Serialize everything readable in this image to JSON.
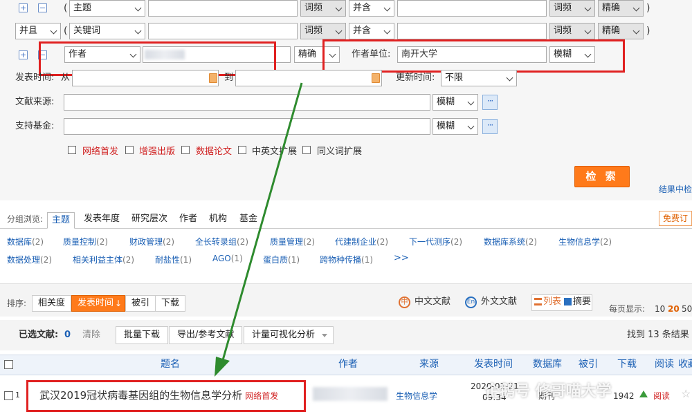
{
  "row1": {
    "field": "主题",
    "freq1": "词频",
    "logic": "并含",
    "freq2": "词频",
    "match": "精确"
  },
  "row2": {
    "op": "并且",
    "field": "关键词",
    "freq1": "词频",
    "logic": "并含",
    "freq2": "词频",
    "match": "精确"
  },
  "row3": {
    "field": "作者",
    "match": "精确",
    "org_label": "作者单位:",
    "org_value": "南开大学",
    "org_match": "模糊"
  },
  "date_row": {
    "label": "发表时间:",
    "from": "从",
    "to": "到",
    "update_label": "更新时间:",
    "update_value": "不限"
  },
  "source_row": {
    "label": "文献来源:",
    "match": "模糊",
    "more": "···"
  },
  "fund_row": {
    "label": "支持基金:",
    "match": "模糊",
    "more": "···"
  },
  "options": [
    {
      "label": "网络首发"
    },
    {
      "label": "增强出版"
    },
    {
      "label": "数据论文"
    },
    {
      "label": "中英文扩展"
    },
    {
      "label": "同义词扩展"
    }
  ],
  "search_button": "检 索",
  "results_link": "结果中检",
  "group": {
    "label": "分组浏览:",
    "tabs": [
      "主题",
      "发表年度",
      "研究层次",
      "作者",
      "机构",
      "基金"
    ],
    "free_sub": "免费订",
    "row1": [
      {
        "name": "数据库",
        "count": "(2)"
      },
      {
        "name": "质量控制",
        "count": "(2)"
      },
      {
        "name": "财政管理",
        "count": "(2)"
      },
      {
        "name": "全长转录组",
        "count": "(2)"
      },
      {
        "name": "质量管理",
        "count": "(2)"
      },
      {
        "name": "代建制企业",
        "count": "(2)"
      },
      {
        "name": "下一代测序",
        "count": "(2)"
      },
      {
        "name": "数据库系统",
        "count": "(2)"
      },
      {
        "name": "生物信息学",
        "count": "(2)"
      }
    ],
    "row2": [
      {
        "name": "数据处理",
        "count": "(2)"
      },
      {
        "name": "相关利益主体",
        "count": "(2)"
      },
      {
        "name": "耐盐性",
        "count": "(1)"
      },
      {
        "name": "AGO",
        "count": "(1)"
      },
      {
        "name": "蛋白质",
        "count": "(1)"
      },
      {
        "name": "跨物种传播",
        "count": "(1)"
      }
    ],
    "more": ">>"
  },
  "sort": {
    "label": "排序:",
    "buttons": [
      "相关度",
      "发表时间",
      "被引",
      "下载"
    ],
    "cn_docs": "中文文献",
    "foreign_docs": "外文文献",
    "list_view": "列表",
    "abstract_view": "摘要",
    "per_page_label": "每页显示:",
    "per_page": [
      "10",
      "20",
      "50"
    ]
  },
  "toolbar": {
    "selected_label": "已选文献:",
    "selected_count": "0",
    "clear": "清除",
    "batch_download": "批量下载",
    "export": "导出/参考文献",
    "visual": "计量可视化分析",
    "found": "找到 13 条结果"
  },
  "table": {
    "headers": [
      "题名",
      "作者",
      "来源",
      "发表时间",
      "数据库",
      "被引",
      "下载",
      "阅读",
      "收藏"
    ],
    "rows": [
      {
        "index": "1",
        "title": "武汉2019冠状病毒基因组的生物信息学分析",
        "badge": "网络首发",
        "source": "生物信息学",
        "date": "2020-01-21",
        "time": "09:34",
        "db": "期刊",
        "downloads": "1942",
        "read": "阅读"
      }
    ]
  },
  "watermark": "企鹅号 修哥喵大学",
  "colors": {
    "accent": "#ff7a1a",
    "link": "#1a5fb4",
    "highlight_box": "#e02020",
    "arrow": "#2e8b2e"
  }
}
